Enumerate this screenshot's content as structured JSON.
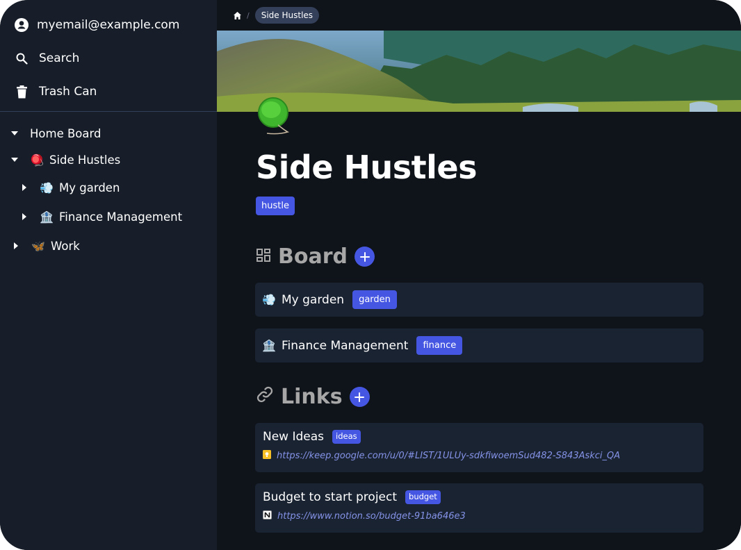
{
  "sidebar": {
    "account": {
      "label": "myemail@example.com",
      "icon": "account-circle-icon"
    },
    "search": {
      "label": "Search",
      "icon": "search-icon"
    },
    "trash": {
      "label": "Trash Can",
      "icon": "trash-icon"
    },
    "tree": [
      {
        "label": "Home Board",
        "emoji": "",
        "expanded": true,
        "level": 0
      },
      {
        "label": "Side Hustles",
        "emoji": "🪀",
        "expanded": true,
        "level": 1
      },
      {
        "label": "My garden",
        "emoji": "💨",
        "expanded": false,
        "level": 2
      },
      {
        "label": "Finance Management",
        "emoji": "🏦",
        "expanded": false,
        "level": 2
      },
      {
        "label": "Work",
        "emoji": "🦋",
        "expanded": false,
        "level": 1
      }
    ]
  },
  "breadcrumb": {
    "home_icon": "home-icon",
    "separator": "/",
    "current": "Side Hustles"
  },
  "page": {
    "icon_emoji": "🪀",
    "title": "Side Hustles",
    "tag": "hustle"
  },
  "board_section": {
    "title": "Board",
    "items": [
      {
        "emoji": "💨",
        "label": "My garden",
        "tag": "garden"
      },
      {
        "emoji": "🏦",
        "label": "Finance Management",
        "tag": "finance"
      }
    ]
  },
  "links_section": {
    "title": "Links",
    "items": [
      {
        "label": "New Ideas",
        "tag": "ideas",
        "favicon": "google-keep-icon",
        "url": "https://keep.google.com/u/0/#LIST/1ULUy-sdkfiwoemSud482-S843Askci_QA"
      },
      {
        "label": "Budget to start project",
        "tag": "budget",
        "favicon": "notion-icon",
        "url": "https://www.notion.so/budget-91ba646e3"
      }
    ]
  },
  "colors": {
    "accent": "#4556e3",
    "sidebar_bg": "#171e29",
    "main_bg": "#0f131a",
    "card_bg": "#1a2332",
    "link": "#8593e8"
  }
}
